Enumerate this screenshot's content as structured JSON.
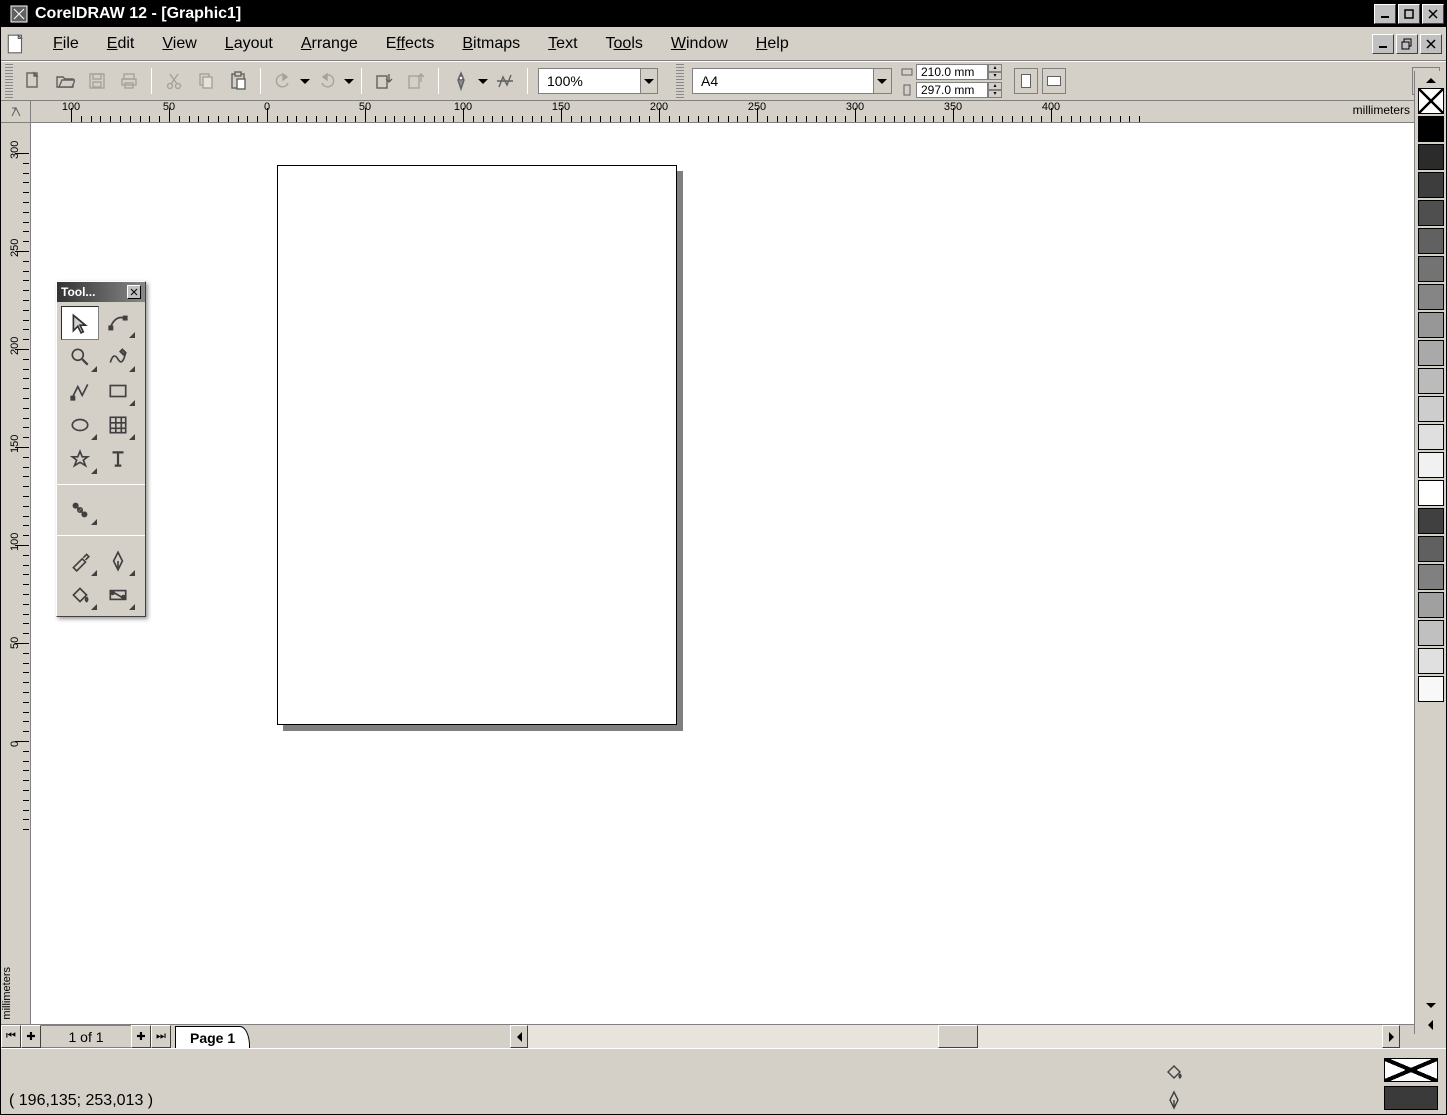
{
  "window": {
    "title": "CorelDRAW 12 - [Graphic1]"
  },
  "menu": {
    "items": [
      {
        "label": "File",
        "accel": "F"
      },
      {
        "label": "Edit",
        "accel": "E"
      },
      {
        "label": "View",
        "accel": "V"
      },
      {
        "label": "Layout",
        "accel": "L"
      },
      {
        "label": "Arrange",
        "accel": "A"
      },
      {
        "label": "Effects",
        "accel": "ff"
      },
      {
        "label": "Bitmaps",
        "accel": "B"
      },
      {
        "label": "Text",
        "accel": "T"
      },
      {
        "label": "Tools",
        "accel": "oo"
      },
      {
        "label": "Window",
        "accel": "W"
      },
      {
        "label": "Help",
        "accel": "H"
      }
    ]
  },
  "standard_toolbar": {
    "new": "new-icon",
    "open": "open-icon",
    "save": "save-icon",
    "print": "print-icon",
    "cut": "cut-icon",
    "copy": "copy-icon",
    "paste": "paste-icon",
    "undo": "undo-icon",
    "redo": "redo-icon",
    "import": "import-icon",
    "export": "export-icon",
    "app_launcher": "app-launcher-icon",
    "corel_online": "corel-online-icon"
  },
  "zoom": {
    "value": "100%"
  },
  "property_bar": {
    "paper": "A4",
    "width": "210.0 mm",
    "height": "297.0 mm",
    "orientation": "portrait"
  },
  "ruler": {
    "units": "millimeters",
    "h_labels": [
      "100",
      "50",
      "0",
      "50",
      "100",
      "150",
      "200",
      "250",
      "300",
      "350",
      "400"
    ],
    "v_labels": [
      "300",
      "250",
      "200",
      "150",
      "100",
      "50",
      "0"
    ]
  },
  "toolbox": {
    "title": "Tool...",
    "tools": [
      {
        "name": "pick-tool",
        "fly": false,
        "selected": true
      },
      {
        "name": "shape-tool",
        "fly": true,
        "selected": false
      },
      {
        "name": "zoom-tool",
        "fly": true,
        "selected": false
      },
      {
        "name": "freehand-tool",
        "fly": true,
        "selected": false
      },
      {
        "name": "smart-drawing-tool",
        "fly": false,
        "selected": false
      },
      {
        "name": "rectangle-tool",
        "fly": true,
        "selected": false
      },
      {
        "name": "ellipse-tool",
        "fly": true,
        "selected": false
      },
      {
        "name": "graph-paper-tool",
        "fly": true,
        "selected": false
      },
      {
        "name": "basic-shapes-tool",
        "fly": true,
        "selected": false
      },
      {
        "name": "text-tool",
        "fly": false,
        "selected": false
      }
    ],
    "tools_group2": [
      {
        "name": "interactive-blend-tool",
        "fly": true,
        "selected": false
      }
    ],
    "tools_group3": [
      {
        "name": "eyedropper-tool",
        "fly": true,
        "selected": false
      },
      {
        "name": "outline-tool",
        "fly": true,
        "selected": false
      },
      {
        "name": "fill-tool",
        "fly": true,
        "selected": false
      },
      {
        "name": "interactive-fill-tool",
        "fly": true,
        "selected": false
      }
    ]
  },
  "color_palette": {
    "swatches": [
      "none",
      "#000000",
      "#2b2b2b",
      "#3d3d3d",
      "#4f4f4f",
      "#616161",
      "#737373",
      "#858585",
      "#979797",
      "#a9a9a9",
      "#bbbbbb",
      "#cdcdcd",
      "#dfdfdf",
      "#f1f1f1",
      "#ffffff",
      "#404040",
      "#606060",
      "#808080",
      "#a0a0a0",
      "#c0c0c0",
      "#e0e0e0",
      "#f8f8f8"
    ]
  },
  "page_nav": {
    "counter": "1 of 1",
    "tab": "Page 1"
  },
  "status": {
    "coords": "( 196,135; 253,013 )",
    "fill": "none",
    "outline": "#3a3a3a"
  }
}
